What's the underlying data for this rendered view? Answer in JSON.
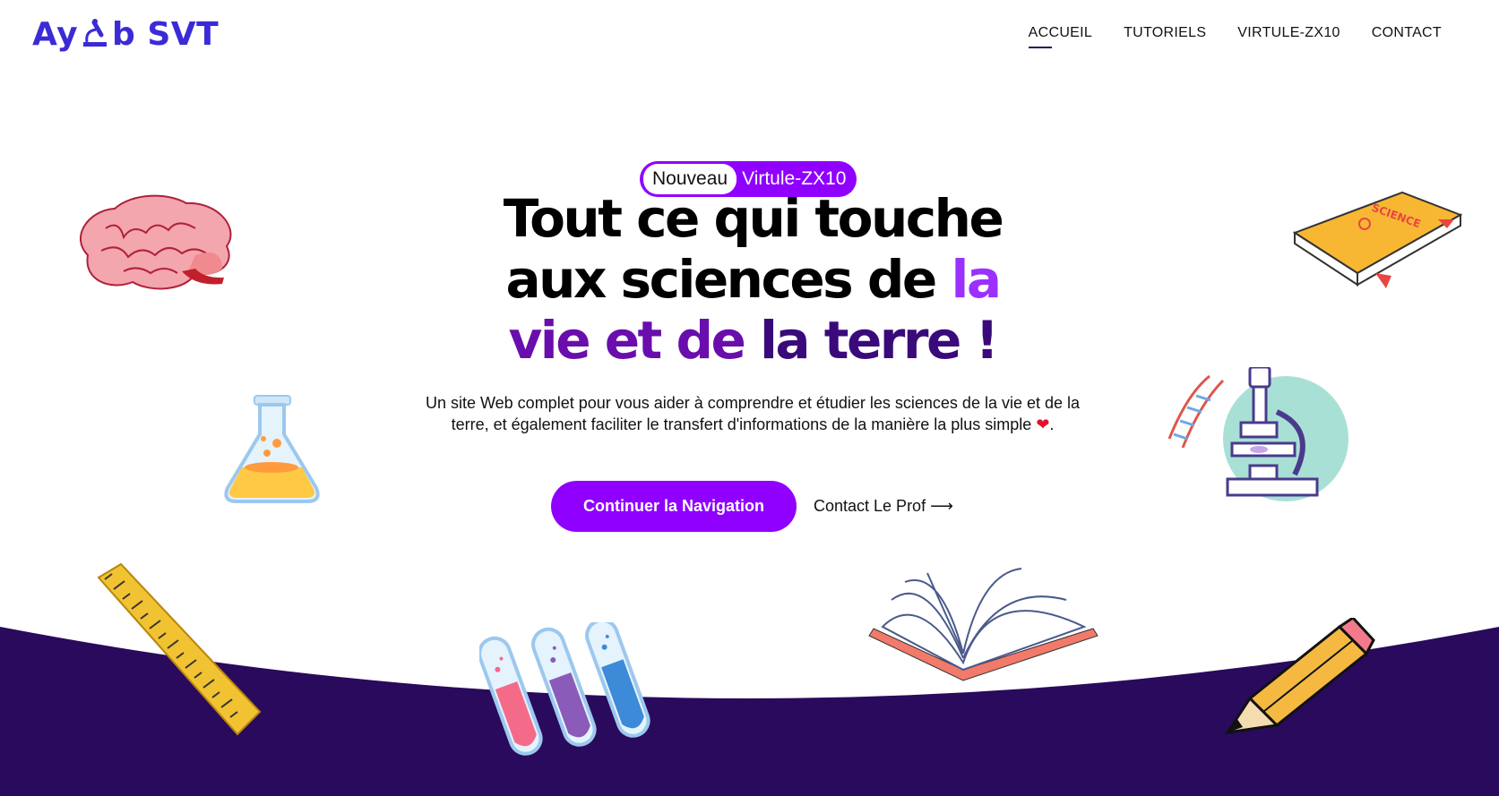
{
  "brand": {
    "logo_left": "Ay",
    "logo_right": "b SVT"
  },
  "nav": {
    "items": [
      {
        "label": "ACCUEIL",
        "active": true
      },
      {
        "label": "TUTORIELS"
      },
      {
        "label": "VIRTULE-ZX10"
      },
      {
        "label": "CONTACT"
      }
    ]
  },
  "hero": {
    "badge_new": "Nouveau",
    "badge_product": "Virtule-ZX10",
    "headline_line1": "Tout ce qui touche",
    "headline_line2_a": "aux sciences de ",
    "headline_line2_b": "la",
    "headline_line3_a": "vie et de ",
    "headline_line3_b": "la terre !",
    "subtitle": "Un site Web complet pour vous aider à comprendre et étudier les sciences de la vie et de la terre, et également faciliter le transfert d'informations de la manière la plus simple",
    "heart": "❤",
    "subtitle_end": ".",
    "cta_primary": "Continuer la Navigation",
    "cta_secondary": "Contact Le Prof ⟶"
  },
  "book_label": "SCIENCE",
  "colors": {
    "accent": "#8f00ff",
    "dark_purple": "#2a0a5c",
    "logo": "#3b2bd6"
  }
}
